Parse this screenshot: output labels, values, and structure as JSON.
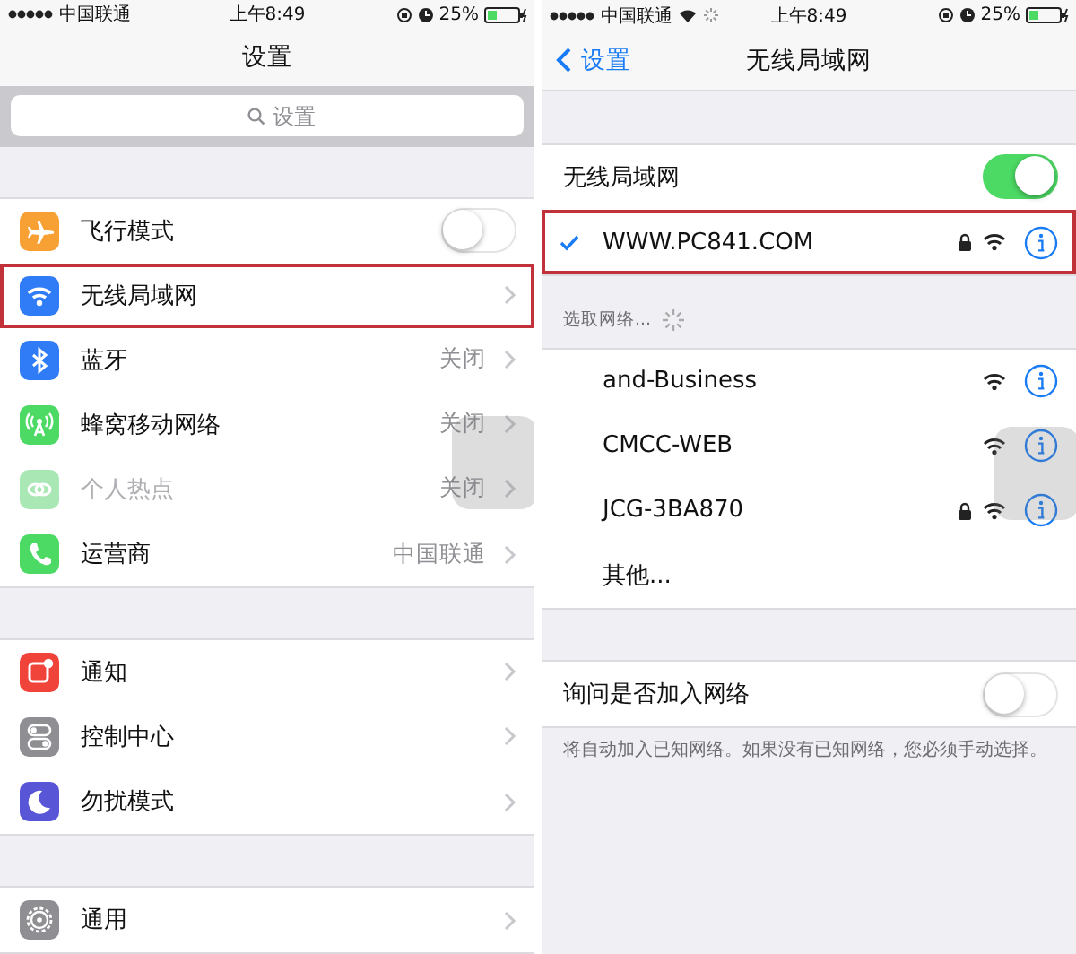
{
  "settings_screen": {
    "status_bar": {
      "carrier": "中国联通",
      "time": "上午8:49",
      "battery": "25%"
    },
    "title": "设置",
    "search": {
      "placeholder": "设置"
    },
    "groups": [
      [
        {
          "kind": "toggle",
          "label": "飞行模式",
          "color": "#f7a033",
          "on": false,
          "disabled": false,
          "highlighted": false
        },
        {
          "kind": "link",
          "label": "无线局域网",
          "color": "#2f7cf6",
          "disabled": false,
          "highlighted": true
        },
        {
          "kind": "link",
          "label": "蓝牙",
          "value": "关闭",
          "color": "#2f7cf6",
          "disabled": false,
          "highlighted": false
        },
        {
          "kind": "link",
          "label": "蜂窝移动网络",
          "value": "关闭",
          "color": "#4cd964",
          "disabled": false,
          "highlighted": false
        },
        {
          "kind": "link",
          "label": "个人热点",
          "value": "关闭",
          "color": "#a9e8b5",
          "disabled": true,
          "highlighted": false
        },
        {
          "kind": "link",
          "label": "运营商",
          "value": "中国联通",
          "color": "#4cd964",
          "disabled": false,
          "highlighted": false
        }
      ],
      [
        {
          "kind": "link",
          "label": "通知",
          "color": "#f0443a",
          "disabled": false,
          "highlighted": false
        },
        {
          "kind": "link",
          "label": "控制中心",
          "color": "#8e8e93",
          "disabled": false,
          "highlighted": false
        },
        {
          "kind": "link",
          "label": "勿扰模式",
          "color": "#5856d6",
          "disabled": false,
          "highlighted": false
        }
      ],
      [
        {
          "kind": "link",
          "label": "通用",
          "color": "#8e8e93",
          "disabled": false,
          "highlighted": false
        }
      ]
    ]
  },
  "wifi_screen": {
    "status_bar": {
      "carrier": "中国联通",
      "time": "上午8:49",
      "battery": "25%"
    },
    "back_button": "设置",
    "title": "无线局域网",
    "wifi_toggle": {
      "label": "无线局域网",
      "on": true
    },
    "current_network": {
      "name": "WWW.PC841.COM",
      "connected": true,
      "locked": true,
      "highlighted": true
    },
    "section_header": "选取网络...",
    "networks": [
      {
        "name": "and-Business",
        "locked": false
      },
      {
        "name": "CMCC-WEB",
        "locked": false
      },
      {
        "name": "JCG-3BA870",
        "locked": true
      }
    ],
    "other": "其他...",
    "ask_to_join": {
      "label": "询问是否加入网络",
      "on": false
    },
    "footer": "将自动加入已知网络。如果没有已知网络，您必须手动选择。"
  }
}
